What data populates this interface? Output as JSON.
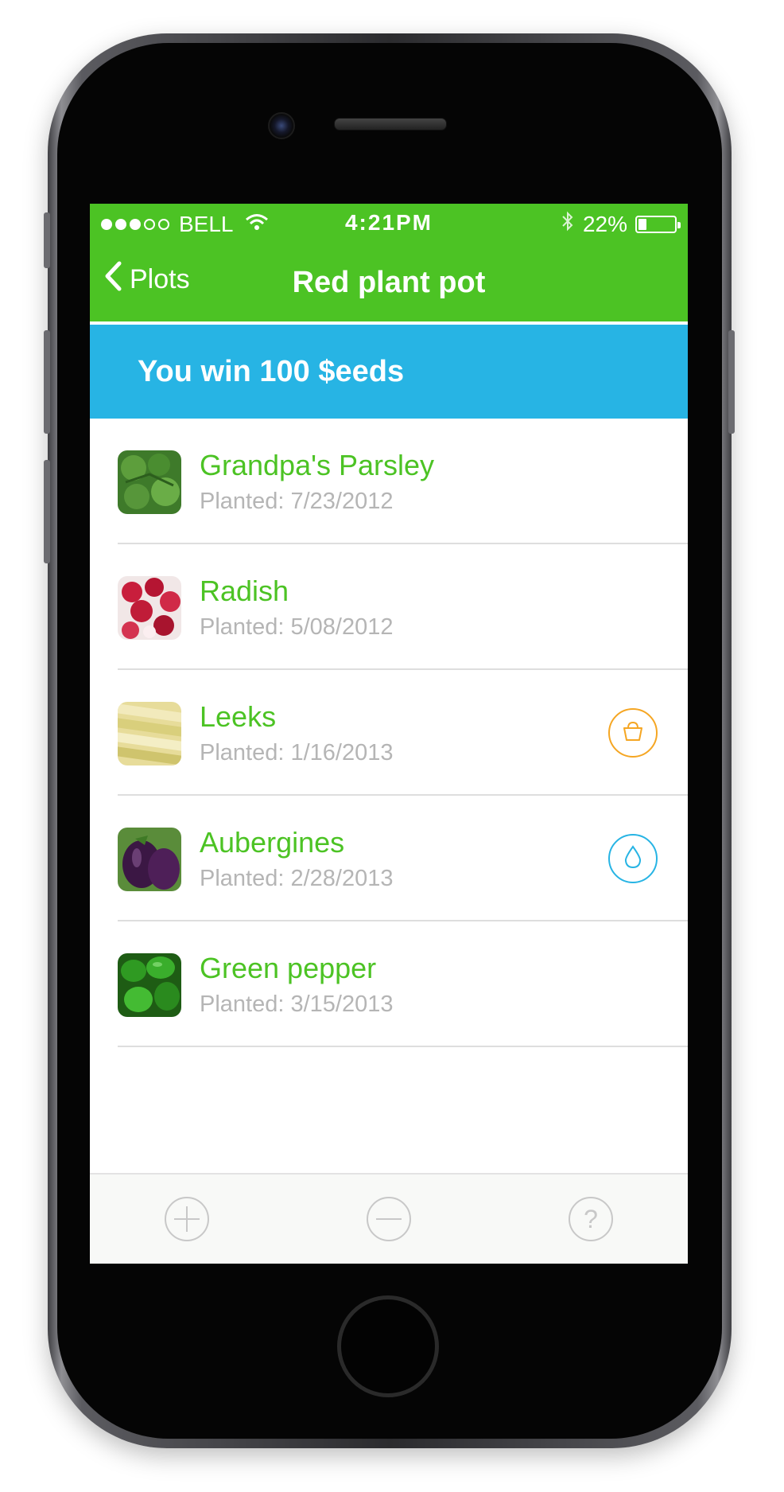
{
  "status_bar": {
    "carrier": "BELL",
    "time": "4:21PM",
    "battery": "22%",
    "battery_level": 0.22,
    "signal_bars_filled": 3,
    "signal_bars_total": 5
  },
  "nav": {
    "back_label": "Plots",
    "title": "Red plant pot"
  },
  "banner": {
    "text": "You win 100 $eeds"
  },
  "plants": [
    {
      "name": "Grandpa's Parsley",
      "date": "Planted: 7/23/2012",
      "action": null
    },
    {
      "name": "Radish",
      "date": "Planted: 5/08/2012",
      "action": null
    },
    {
      "name": "Leeks",
      "date": "Planted: 1/16/2013",
      "action": "basket-icon"
    },
    {
      "name": "Aubergines",
      "date": "Planted: 2/28/2013",
      "action": "water-drop-icon"
    },
    {
      "name": "Green pepper",
      "date": "Planted: 3/15/2013",
      "action": null
    }
  ],
  "toolbar": {
    "add_icon": "plus-icon",
    "remove_icon": "minus-icon",
    "help_icon": "question-icon"
  },
  "colors": {
    "brand_green": "#4cc324",
    "banner_blue": "#27b4e4",
    "harvest_orange": "#f5a623",
    "water_blue": "#27b4e4",
    "muted_text": "#b5b5b5"
  }
}
